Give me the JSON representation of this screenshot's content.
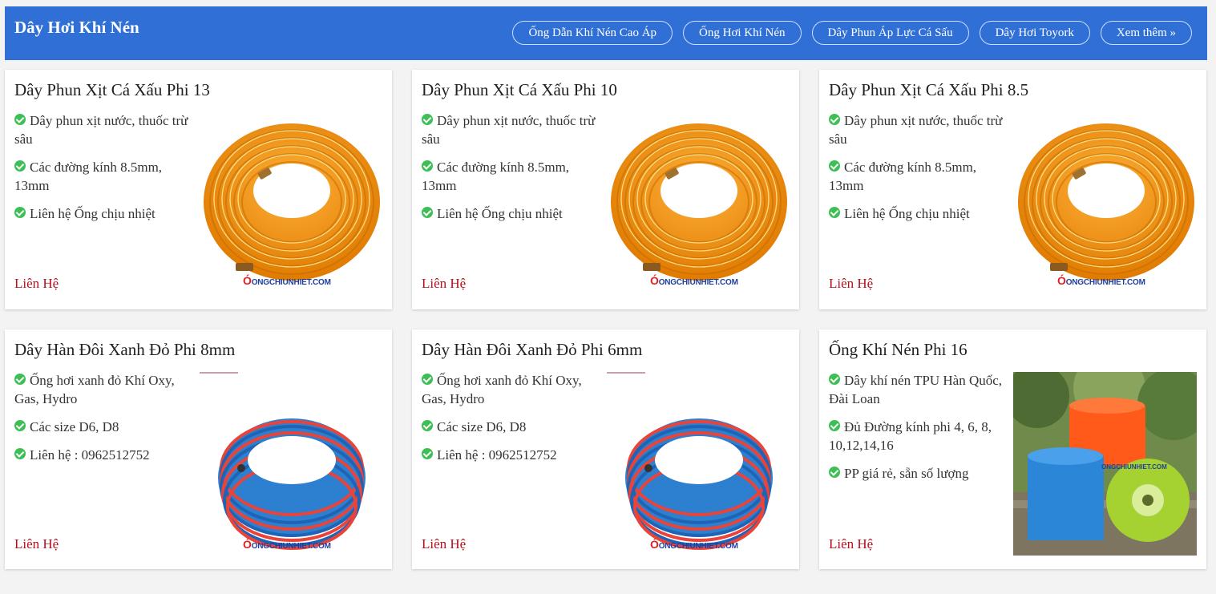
{
  "header": {
    "title": "Dây Hơi Khí Nén",
    "links": [
      "Ống Dẫn Khí Nén Cao Áp",
      "Ống Hơi Khí Nén",
      "Dây Phun Áp Lực Cá Sấu",
      "Dây Hơi Toyork"
    ],
    "more_label": "Xem thêm »"
  },
  "watermark": "ONGCHIUNHIET.COM",
  "products": [
    {
      "title": "Dây Phun Xịt Cá Xấu Phi 13",
      "features": [
        "Dây phun xịt nước, thuốc trừ sâu",
        "Các đường kính 8.5mm, 13mm",
        "Liên hệ Ống chịu nhiệt"
      ],
      "contact": "Liên Hệ",
      "image": "orange-hose-coil"
    },
    {
      "title": "Dây Phun Xịt Cá Xấu Phi 10",
      "features": [
        "Dây phun xịt nước, thuốc trừ sâu",
        "Các đường kính 8.5mm, 13mm",
        "Liên hệ Ống chịu nhiệt"
      ],
      "contact": "Liên Hệ",
      "image": "orange-hose-coil"
    },
    {
      "title": "Dây Phun Xịt Cá Xấu Phi 8.5",
      "features": [
        "Dây phun xịt nước, thuốc trừ sâu",
        "Các đường kính 8.5mm, 13mm",
        "Liên hệ Ống chịu nhiệt"
      ],
      "contact": "Liên Hệ",
      "image": "orange-hose-coil"
    },
    {
      "title": "Dây Hàn Đôi Xanh Đỏ Phi 8mm",
      "features": [
        "Ống hơi xanh đỏ Khí Oxy, Gas, Hydro",
        "Các size D6, D8",
        "Liên hệ : 0962512752"
      ],
      "contact": "Liên Hệ",
      "image": "blue-red-twin-hose-coil"
    },
    {
      "title": "Dây Hàn Đôi Xanh Đỏ Phi 6mm",
      "features": [
        "Ống hơi xanh đỏ Khí Oxy, Gas, Hydro",
        "Các size D6, D8",
        "Liên hệ : 0962512752"
      ],
      "contact": "Liên Hệ",
      "image": "blue-red-twin-hose-coil"
    },
    {
      "title": "Ống Khí Nén Phi 16",
      "features": [
        "Dây khí nén TPU Hàn Quốc, Đài Loan",
        "Đủ Đường kính phi 4, 6, 8, 10,12,14,16",
        "PP giá rẻ, sẵn số lượng"
      ],
      "contact": "Liên Hệ",
      "image": "tpu-hose-reels-photo"
    }
  ],
  "colors": {
    "header_bg": "#2f6fd6",
    "contact": "#b2101d",
    "check": "#3dbf55"
  }
}
